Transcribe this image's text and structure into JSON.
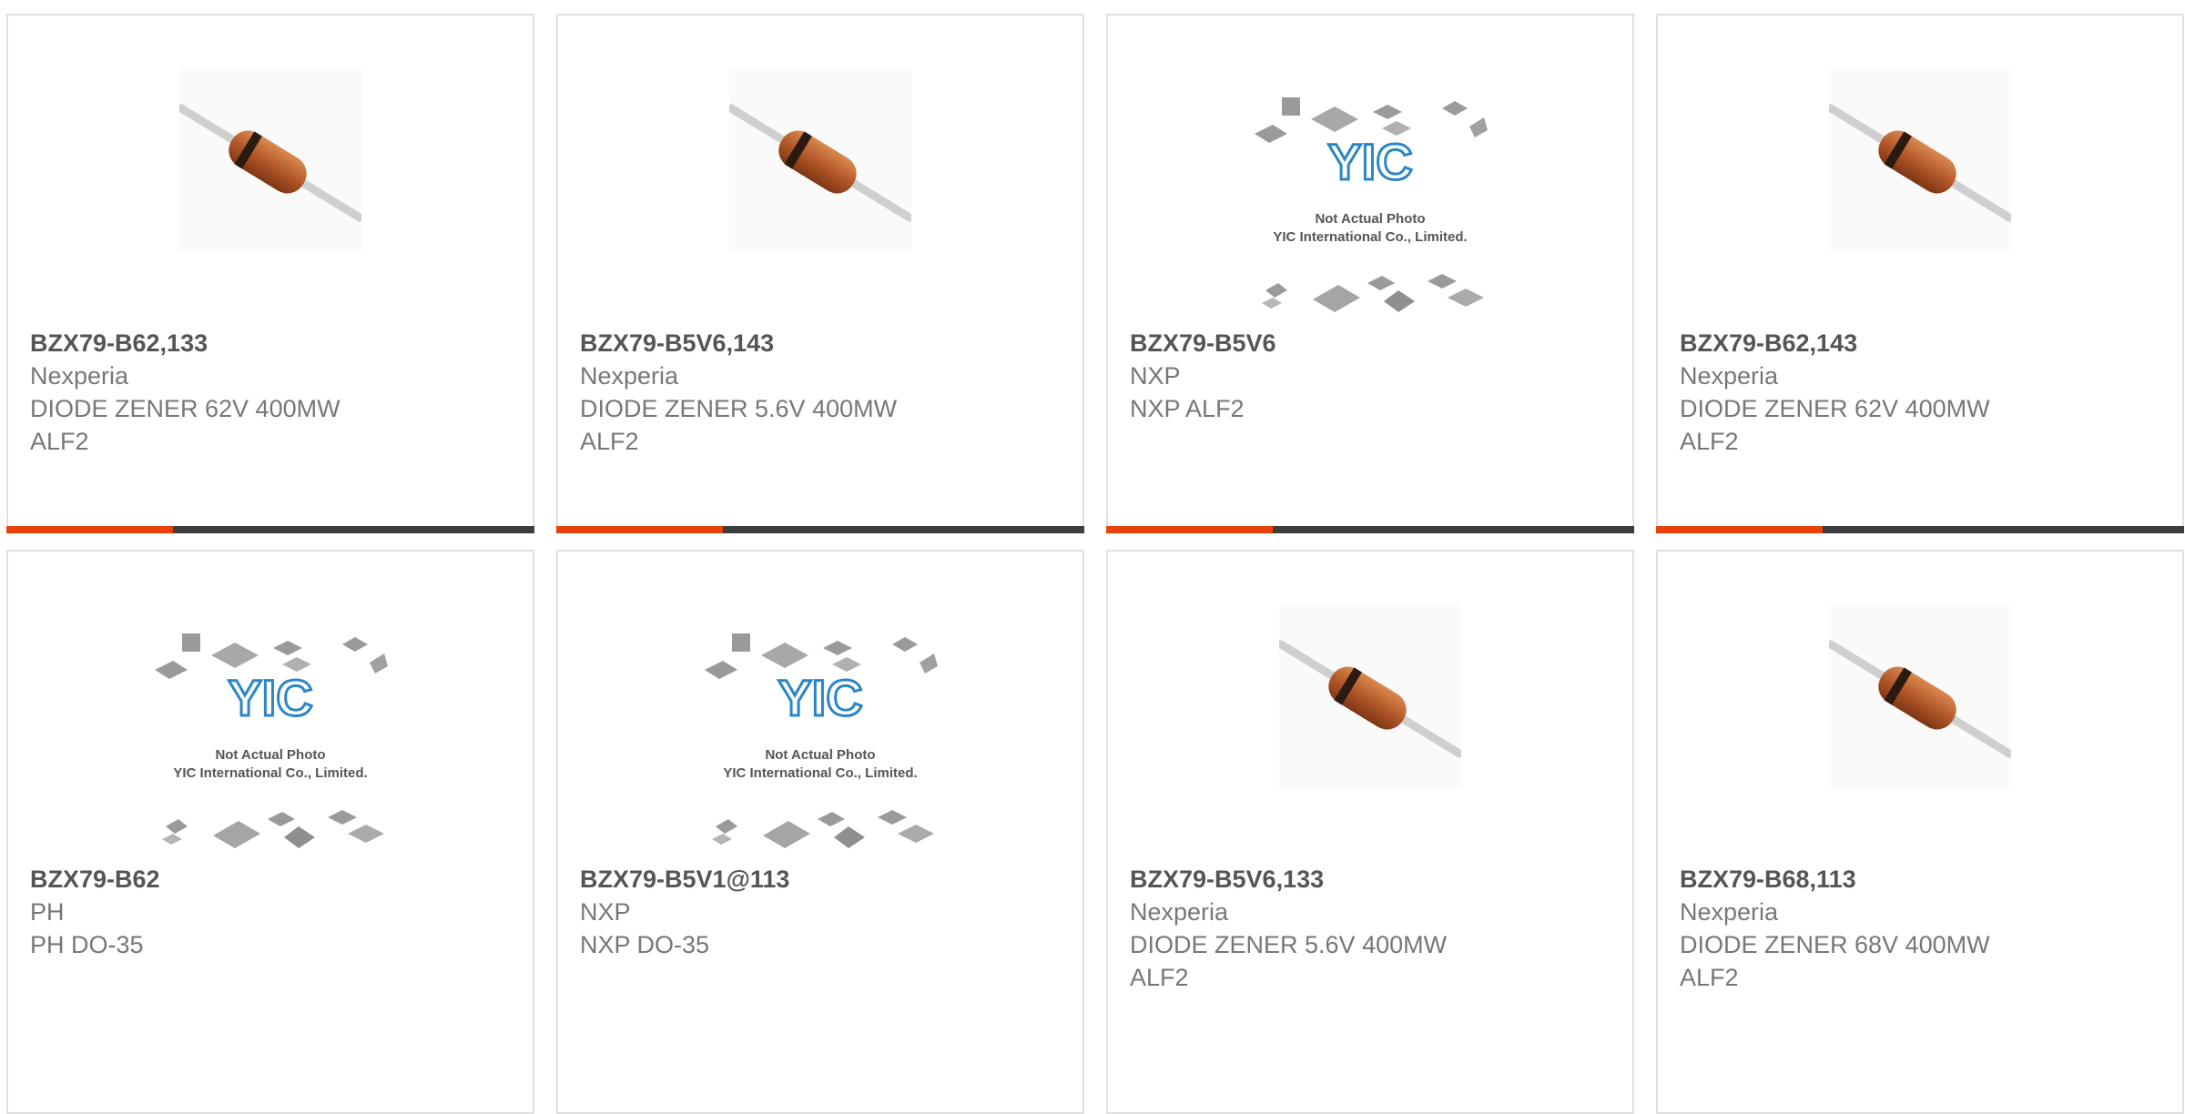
{
  "colors": {
    "accent": "#e8410c",
    "bar": "#3d3d3d",
    "part": "#555555",
    "text": "#777777",
    "border": "#e0e0e0"
  },
  "placeholder": {
    "line1": "Not Actual Photo",
    "line2": "YIC International Co., Limited.",
    "logo": "YIC"
  },
  "products": [
    {
      "part": "BZX79-B62,133",
      "maker": "Nexperia",
      "desc1": "DIODE ZENER 62V 400MW",
      "desc2": "ALF2",
      "image": "diode-photo",
      "selected": true
    },
    {
      "part": "BZX79-B5V6,143",
      "maker": "Nexperia",
      "desc1": "DIODE ZENER 5.6V 400MW",
      "desc2": "ALF2",
      "image": "diode-photo",
      "selected": true
    },
    {
      "part": "BZX79-B5V6",
      "maker": "NXP",
      "desc1": "NXP ALF2",
      "desc2": "",
      "image": "yic-placeholder",
      "selected": true
    },
    {
      "part": "BZX79-B62,143",
      "maker": "Nexperia",
      "desc1": "DIODE ZENER 62V 400MW",
      "desc2": "ALF2",
      "image": "diode-photo",
      "selected": true
    },
    {
      "part": "BZX79-B62",
      "maker": "PH",
      "desc1": "PH DO-35",
      "desc2": "",
      "image": "yic-placeholder",
      "selected": false
    },
    {
      "part": "BZX79-B5V1@113",
      "maker": "NXP",
      "desc1": "NXP DO-35",
      "desc2": "",
      "image": "yic-placeholder",
      "selected": false
    },
    {
      "part": "BZX79-B5V6,133",
      "maker": "Nexperia",
      "desc1": "DIODE ZENER 5.6V 400MW",
      "desc2": "ALF2",
      "image": "diode-photo",
      "selected": false
    },
    {
      "part": "BZX79-B68,113",
      "maker": "Nexperia",
      "desc1": "DIODE ZENER 68V 400MW",
      "desc2": "ALF2",
      "image": "diode-photo",
      "selected": false
    }
  ]
}
